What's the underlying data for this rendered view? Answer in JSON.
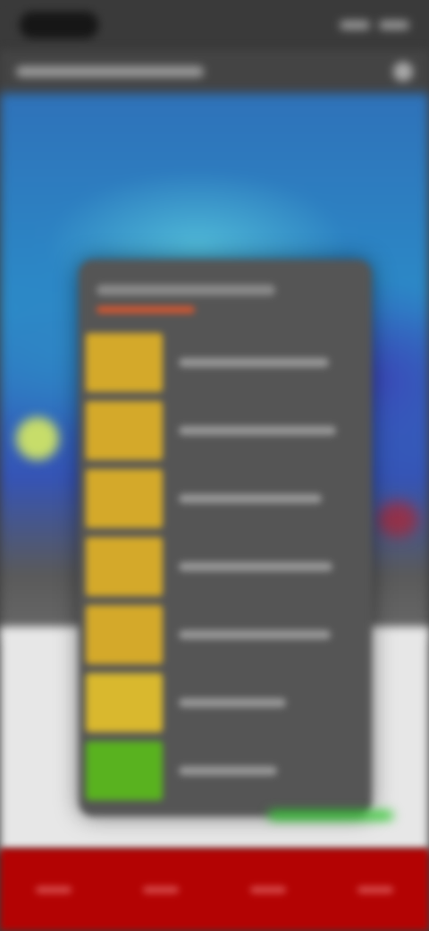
{
  "colors": {
    "status_bar": "#3a3a3a",
    "title_bar": "#444444",
    "map_primary": "#2f72b9",
    "map_highlight": "#4fb7d6",
    "ground": "#e7e7e7",
    "bottom_strip": "#b30303",
    "legend_panel": "#555555",
    "swatch_yellow": "#d4a92a",
    "swatch_green": "#59b21f",
    "map_marker": "#c7dd6a"
  },
  "legend": {
    "swatches": [
      "#d4a92a",
      "#d4a92a",
      "#d4a92a",
      "#d4a92a",
      "#d4a92a",
      "#d9b82e",
      "#59b21f"
    ]
  },
  "icons": {
    "menu": "more-icon",
    "marker": "map-marker-icon"
  }
}
